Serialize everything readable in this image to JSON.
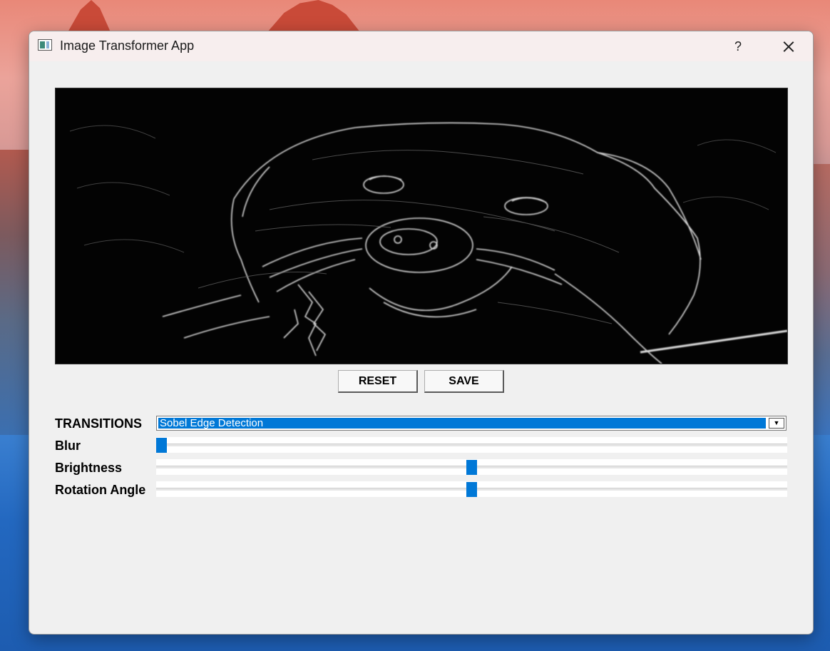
{
  "window": {
    "title": "Image Transformer App",
    "help_label": "?"
  },
  "image": {
    "description_icon": "image-preview",
    "filter_applied": "Sobel Edge Detection"
  },
  "buttons": {
    "reset_label": "RESET",
    "save_label": "SAVE"
  },
  "controls": {
    "transitions_label": "TRANSITIONS",
    "transitions_value": "Sobel Edge Detection",
    "blur_label": "Blur",
    "blur_value": 0,
    "brightness_label": "Brightness",
    "brightness_value": 0.5,
    "rotation_label": "Rotation Angle",
    "rotation_value": 0.5
  },
  "colors": {
    "accent": "#0078d7",
    "window_bg": "#f0f0f0",
    "titlebar_bg": "#f7eeee"
  },
  "icons": {
    "app": "app-window-icon",
    "close": "close-icon",
    "dropdown": "chevron-down-icon"
  }
}
